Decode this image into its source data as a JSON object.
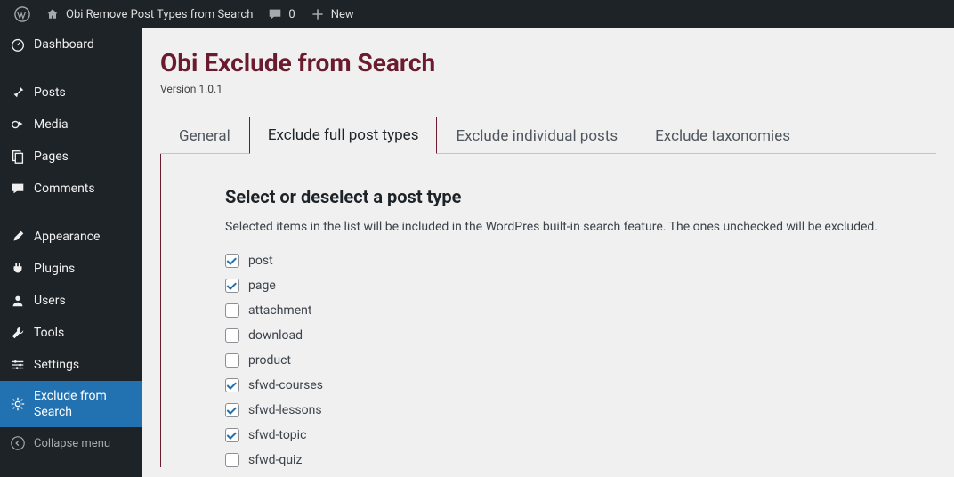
{
  "adminbar": {
    "site_name": "Obi Remove Post Types from Search",
    "comments_count": "0",
    "new_label": "New"
  },
  "sidebar": {
    "items": [
      {
        "id": "dashboard",
        "label": "Dashboard",
        "icon": "dashboard"
      },
      {
        "sep": true
      },
      {
        "id": "posts",
        "label": "Posts",
        "icon": "pin"
      },
      {
        "id": "media",
        "label": "Media",
        "icon": "media"
      },
      {
        "id": "pages",
        "label": "Pages",
        "icon": "pages"
      },
      {
        "id": "comments",
        "label": "Comments",
        "icon": "comment"
      },
      {
        "sep": true
      },
      {
        "id": "appearance",
        "label": "Appearance",
        "icon": "brush"
      },
      {
        "id": "plugins",
        "label": "Plugins",
        "icon": "plug"
      },
      {
        "id": "users",
        "label": "Users",
        "icon": "user"
      },
      {
        "id": "tools",
        "label": "Tools",
        "icon": "wrench"
      },
      {
        "id": "settings",
        "label": "Settings",
        "icon": "sliders"
      },
      {
        "id": "exclude-search",
        "label": "Exclude from Search",
        "icon": "gear",
        "current": true,
        "multiline": true
      },
      {
        "id": "collapse",
        "label": "Collapse menu",
        "icon": "collapse",
        "collapse": true
      }
    ]
  },
  "main": {
    "title": "Obi Exclude from Search",
    "version": "Version 1.0.1",
    "tabs": [
      {
        "id": "general",
        "label": "General"
      },
      {
        "id": "exclude-post-types",
        "label": "Exclude full post types",
        "active": true
      },
      {
        "id": "exclude-posts",
        "label": "Exclude individual posts"
      },
      {
        "id": "exclude-taxonomies",
        "label": "Exclude taxonomies"
      }
    ],
    "panel": {
      "heading": "Select or deselect a post type",
      "description": "Selected items in the list will be included in the WordPres built-in search feature. The ones unchecked will be excluded.",
      "post_types": [
        {
          "slug": "post",
          "checked": true
        },
        {
          "slug": "page",
          "checked": true
        },
        {
          "slug": "attachment",
          "checked": false
        },
        {
          "slug": "download",
          "checked": false
        },
        {
          "slug": "product",
          "checked": false
        },
        {
          "slug": "sfwd-courses",
          "checked": true
        },
        {
          "slug": "sfwd-lessons",
          "checked": true
        },
        {
          "slug": "sfwd-topic",
          "checked": true
        },
        {
          "slug": "sfwd-quiz",
          "checked": false
        }
      ]
    }
  }
}
